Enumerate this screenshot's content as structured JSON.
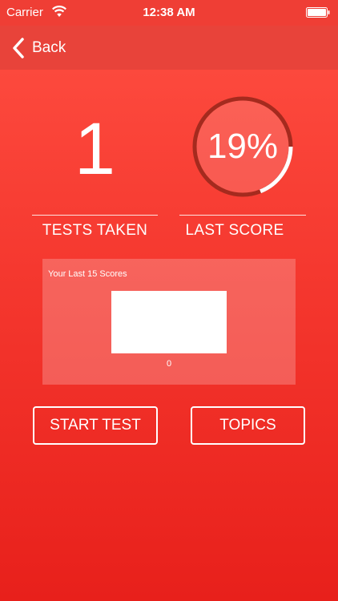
{
  "status_bar": {
    "carrier": "Carrier",
    "time": "12:38 AM",
    "icons": [
      "wifi-icon",
      "battery-icon"
    ]
  },
  "nav": {
    "back_label": "Back",
    "back_icon": "chevron-left-icon"
  },
  "stats": {
    "tests_taken": "1",
    "tests_taken_label": "TESTS TAKEN",
    "last_score": "19%",
    "last_score_fraction": 0.19,
    "last_score_label": "LAST SCORE"
  },
  "scores_panel": {
    "title": "Your Last 15 Scores",
    "axis_label": "0"
  },
  "actions": {
    "start_label": "START TEST",
    "topics_label": "TOPICS"
  },
  "colors": {
    "background_top": "#ff4f42",
    "background_bottom": "#e8201b",
    "nav": "#e8433a",
    "gauge_track": "#a52a1e",
    "gauge_progress": "#ffffff"
  }
}
